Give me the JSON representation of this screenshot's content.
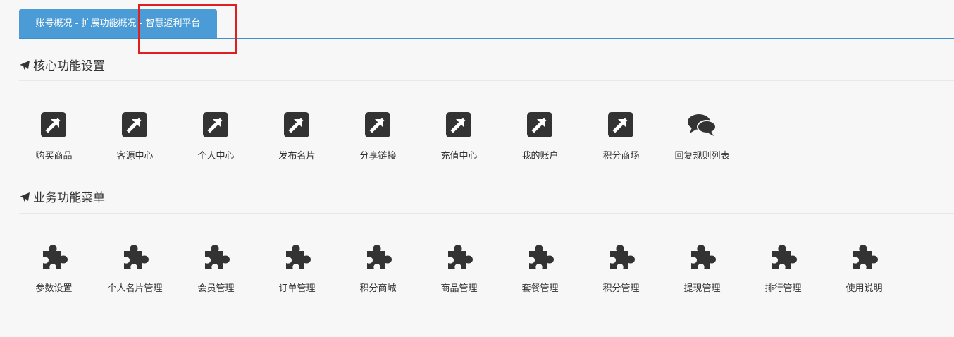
{
  "tab": {
    "label": "账号概况 - 扩展功能概况 - 智慧返利平台"
  },
  "colors": {
    "tab_bg": "#4a9bd6",
    "icon": "#333333",
    "highlight": "#e02020"
  },
  "core_section": {
    "title": "核心功能设置",
    "items": [
      {
        "label": "购买商品",
        "icon": "external-link-icon"
      },
      {
        "label": "客源中心",
        "icon": "external-link-icon"
      },
      {
        "label": "个人中心",
        "icon": "external-link-icon"
      },
      {
        "label": "发布名片",
        "icon": "external-link-icon"
      },
      {
        "label": "分享链接",
        "icon": "external-link-icon"
      },
      {
        "label": "充值中心",
        "icon": "external-link-icon"
      },
      {
        "label": "我的账户",
        "icon": "external-link-icon"
      },
      {
        "label": "积分商场",
        "icon": "external-link-icon"
      },
      {
        "label": "回复规则列表",
        "icon": "comments-icon"
      }
    ]
  },
  "business_section": {
    "title": "业务功能菜单",
    "items": [
      {
        "label": "参数设置",
        "icon": "puzzle-icon"
      },
      {
        "label": "个人名片管理",
        "icon": "puzzle-icon"
      },
      {
        "label": "会员管理",
        "icon": "puzzle-icon"
      },
      {
        "label": "订单管理",
        "icon": "puzzle-icon"
      },
      {
        "label": "积分商城",
        "icon": "puzzle-icon"
      },
      {
        "label": "商品管理",
        "icon": "puzzle-icon"
      },
      {
        "label": "套餐管理",
        "icon": "puzzle-icon"
      },
      {
        "label": "积分管理",
        "icon": "puzzle-icon"
      },
      {
        "label": "提现管理",
        "icon": "puzzle-icon"
      },
      {
        "label": "排行管理",
        "icon": "puzzle-icon"
      },
      {
        "label": "使用说明",
        "icon": "puzzle-icon"
      }
    ]
  }
}
